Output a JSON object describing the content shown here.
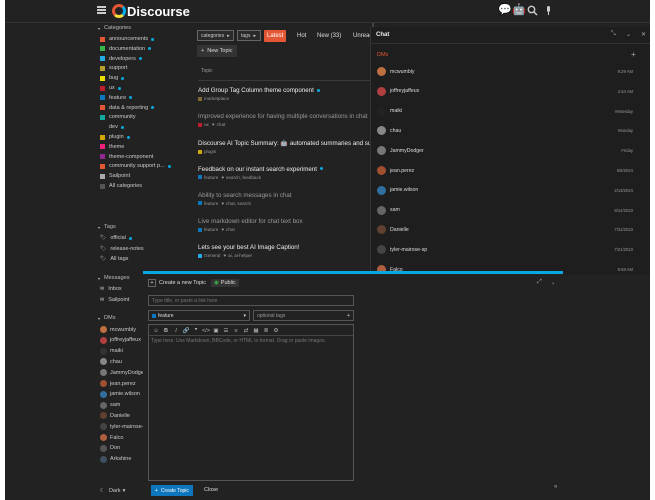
{
  "header": {
    "logo": "Discourse"
  },
  "sidebar": {
    "categories_heading": "Categories",
    "categories": [
      {
        "label": "announcements",
        "color": "#e45735",
        "dot": true
      },
      {
        "label": "documentation",
        "color": "#3ab54a",
        "dot": true
      },
      {
        "label": "developers",
        "color": "#25aae2",
        "dot": true
      },
      {
        "label": "support",
        "color": "#b4a02e",
        "dot": false
      },
      {
        "label": "bug",
        "color": "#e9dd00",
        "dot": true
      },
      {
        "label": "ux",
        "color": "#bf1e2e",
        "dot": true
      },
      {
        "label": "feature",
        "color": "#0e76bd",
        "dot": true
      },
      {
        "label": "data & reporting",
        "color": "#e45735",
        "dot": true
      },
      {
        "label": "community",
        "color": "#12a89d",
        "dot": false
      },
      {
        "label": "dev",
        "color": "#222222",
        "dot": true
      },
      {
        "label": "plugin",
        "color": "#d2a700",
        "dot": true
      },
      {
        "label": "theme",
        "color": "#ed207b",
        "dot": false
      },
      {
        "label": "theme-component",
        "color": "#92278f",
        "dot": false
      },
      {
        "label": "community support p...",
        "color": "#e45735",
        "dot": true
      },
      {
        "label": "Sailpoint",
        "color": "#aaaaaa",
        "dot": false
      },
      {
        "label": "All categories",
        "color": "#555555",
        "dot": false
      }
    ],
    "tags_heading": "Tags",
    "tags": [
      {
        "label": "official",
        "dot": true
      },
      {
        "label": "release-notes",
        "dot": false
      },
      {
        "label": "All tags",
        "dot": false
      }
    ],
    "messages_heading": "Messages",
    "messages": [
      {
        "label": "Inbox"
      },
      {
        "label": "Sailpoint"
      }
    ],
    "dms_heading": "DMs",
    "dms": [
      {
        "label": "mcwumbly",
        "color": "#c07040"
      },
      {
        "label": "joffreyjaffeux",
        "color": "#b04040"
      },
      {
        "label": "maiki",
        "color": "#333333"
      },
      {
        "label": "chau",
        "color": "#888888"
      },
      {
        "label": "JammyDodger",
        "color": "#777777"
      },
      {
        "label": "jean.perez",
        "color": "#a05030"
      },
      {
        "label": "jamie.wilson",
        "color": "#3070a0"
      },
      {
        "label": "sam",
        "color": "#666666"
      },
      {
        "label": "Danielle",
        "color": "#604030"
      },
      {
        "label": "tyler-mairose-sp",
        "color": "#444444"
      },
      {
        "label": "Falco",
        "color": "#b06040"
      },
      {
        "label": "Don",
        "color": "#555555"
      },
      {
        "label": "Arkshine",
        "color": "#405060"
      }
    ],
    "theme_label": "Dark"
  },
  "filters": {
    "categories": "categories",
    "tags": "tags"
  },
  "nav": {
    "latest": "Latest",
    "hot": "Hot",
    "new": "New (33)",
    "unread": "Unread"
  },
  "new_topic": "New Topic",
  "topic_col": "Topic",
  "topics": [
    {
      "title": "Add Group Tag Column theme component",
      "cat": "marketplace",
      "cat_color": "#7d6b36",
      "tags": "",
      "read": false,
      "dot": true
    },
    {
      "title": "Improved experience for having multiple conversations in chat",
      "cat": "ux",
      "cat_color": "#bf1e2e",
      "tags": "chat",
      "read": true,
      "dot": false
    },
    {
      "title": "Discourse AI Topic Summary: 🤖 automated summaries and su",
      "cat": "plugin",
      "cat_color": "#d2a700",
      "tags": "",
      "read": false,
      "dot": false
    },
    {
      "title": "Feedback on our instant search experiment",
      "cat": "feature",
      "cat_color": "#0e76bd",
      "tags": "search, feedback",
      "read": false,
      "dot": true
    },
    {
      "title": "Ability to search messages in chat",
      "cat": "feature",
      "cat_color": "#0e76bd",
      "tags": "chat, search",
      "read": true,
      "dot": false
    },
    {
      "title": "Live markdown editor for chat text box",
      "cat": "feature",
      "cat_color": "#0e76bd",
      "tags": "chat",
      "read": true,
      "dot": false
    },
    {
      "title": "Lets see your best AI Image Caption!",
      "cat": "General",
      "cat_color": "#25aae2",
      "tags": "ai, ai-helper",
      "read": false,
      "dot": false
    }
  ],
  "chat": {
    "title": "Chat",
    "dms_label": "DMs",
    "rows": [
      {
        "name": "mcwumbly",
        "time": "9:29 AM",
        "color": "#c07040"
      },
      {
        "name": "joffreyjaffeux",
        "time": "4:34 AM",
        "color": "#b04040"
      },
      {
        "name": "maiki",
        "time": "Yesterday",
        "color": "#222222"
      },
      {
        "name": "chau",
        "time": "Monday",
        "color": "#888888"
      },
      {
        "name": "JammyDodger",
        "time": "Friday",
        "color": "#777777"
      },
      {
        "name": "jean.perez",
        "time": "5/6/2024",
        "color": "#a05030"
      },
      {
        "name": "jamie.wilson",
        "time": "2/13/2024",
        "color": "#3070a0"
      },
      {
        "name": "sam",
        "time": "8/14/2023",
        "color": "#666666"
      },
      {
        "name": "Danielle",
        "time": "7/31/2023",
        "color": "#604030"
      },
      {
        "name": "tyler-mairose-sp",
        "time": "7/21/2023",
        "color": "#444444"
      },
      {
        "name": "Falco",
        "time": "9:58 AM",
        "color": "#b06040"
      }
    ]
  },
  "composer": {
    "action": "Create a new Topic",
    "visibility": "Public",
    "title_placeholder": "Type title, or paste a link here",
    "category": "feature",
    "tags_placeholder": "optional tags",
    "body_placeholder": "Type here. Use Markdown, BBCode, or HTML to format. Drag or paste images.",
    "submit": "Create Topic",
    "close": "Close"
  }
}
